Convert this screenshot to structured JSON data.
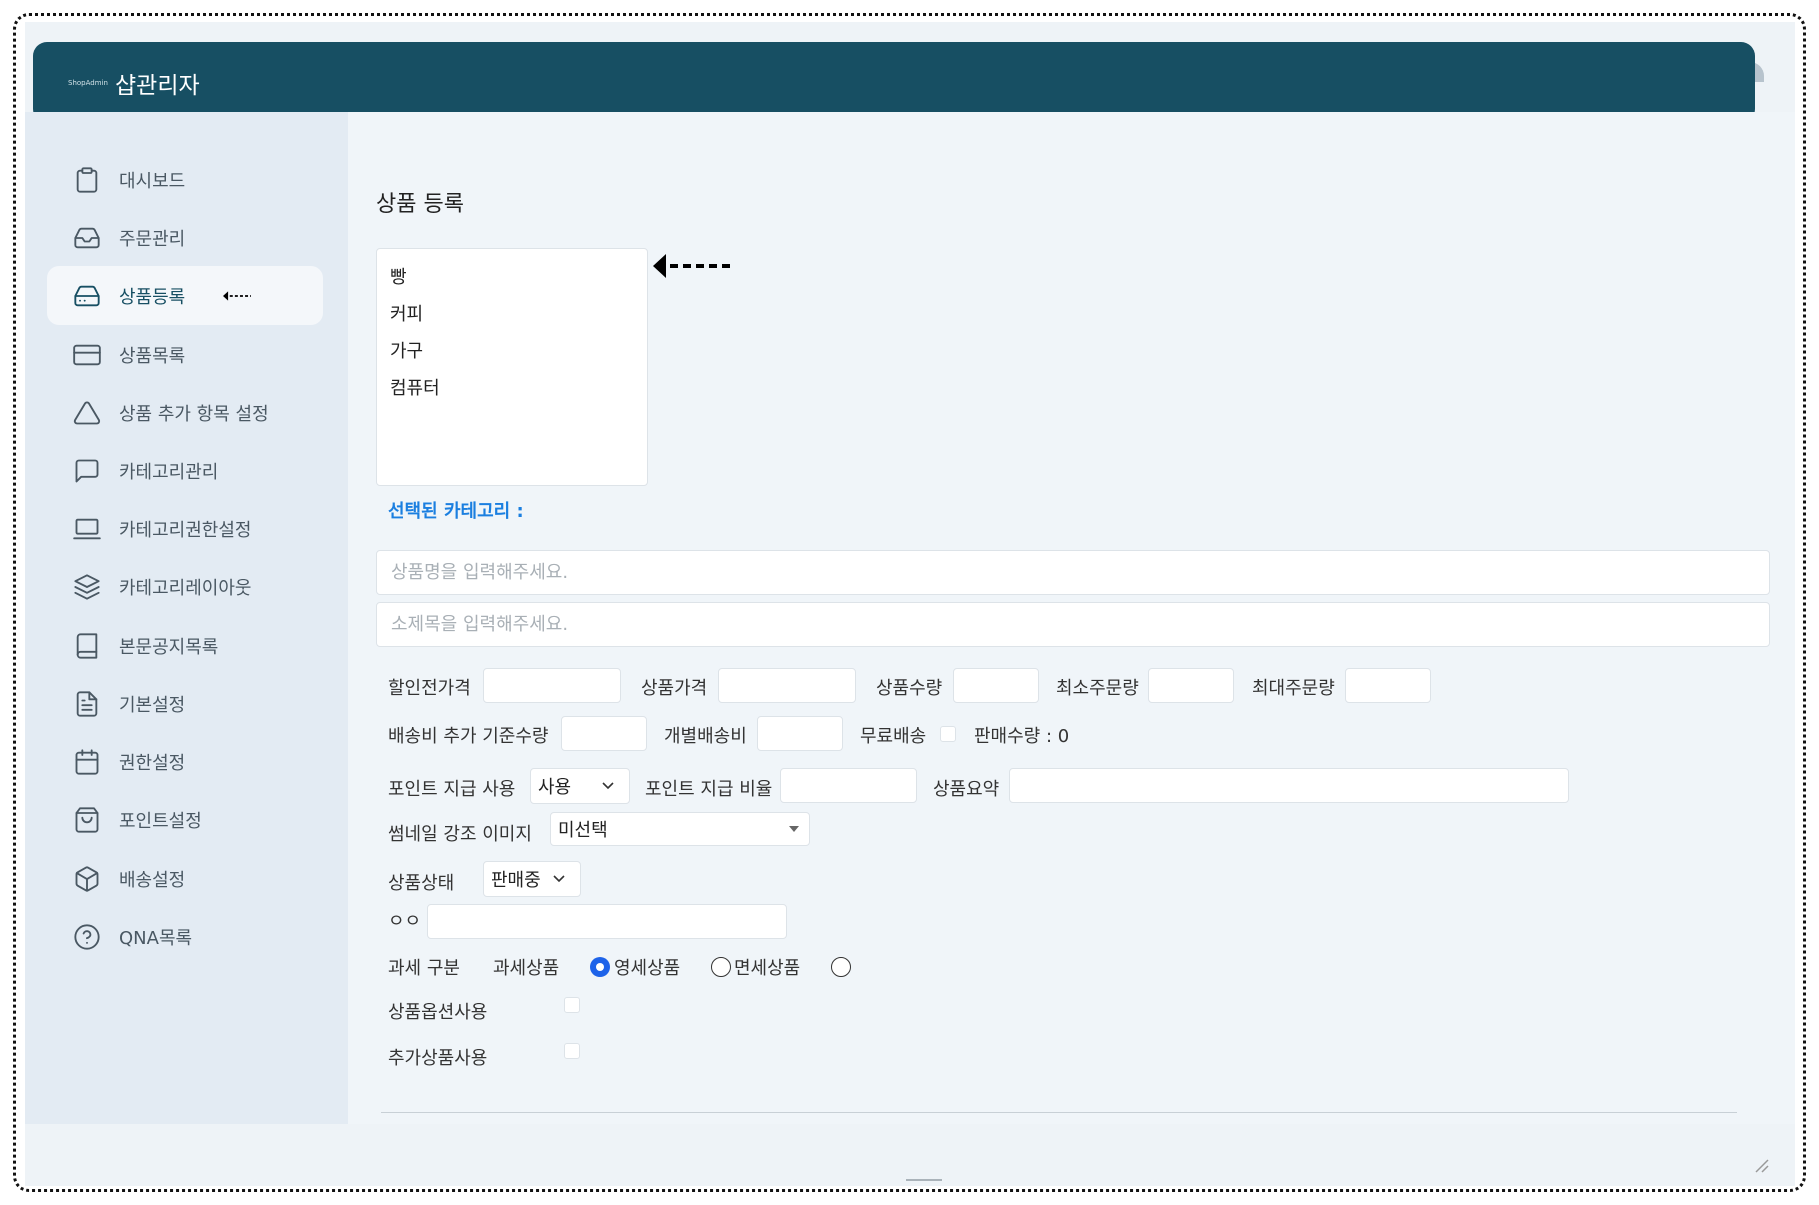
{
  "header": {
    "logo_text": "ShopAdmin",
    "title": "샵관리자"
  },
  "sidebar": {
    "items": [
      {
        "label": "대시보드",
        "icon": "clipboard-icon"
      },
      {
        "label": "주문관리",
        "icon": "inbox-icon"
      },
      {
        "label": "상품등록",
        "icon": "hard-drive-icon",
        "active": true
      },
      {
        "label": "상품목록",
        "icon": "credit-card-icon"
      },
      {
        "label": "상품 추가 항목 설정",
        "icon": "triangle-icon"
      },
      {
        "label": "카테고리관리",
        "icon": "message-square-icon"
      },
      {
        "label": "카테고리권한설정",
        "icon": "laptop-icon"
      },
      {
        "label": "카테고리레이아웃",
        "icon": "layers-icon"
      },
      {
        "label": "본문공지목록",
        "icon": "book-icon"
      },
      {
        "label": "기본설정",
        "icon": "file-text-icon"
      },
      {
        "label": "권한설정",
        "icon": "calendar-icon"
      },
      {
        "label": "포인트설정",
        "icon": "shopping-bag-icon"
      },
      {
        "label": "배송설정",
        "icon": "box-icon"
      },
      {
        "label": "QNA목록",
        "icon": "help-circle-icon"
      }
    ]
  },
  "main": {
    "title": "상품 등록",
    "categories": [
      "빵",
      "커피",
      "가구",
      "컴퓨터"
    ],
    "selected_category_label": "선택된 카테고리 :",
    "product_name_placeholder": "상품명을 입력해주세요.",
    "subtitle_placeholder": "소제목을 입력해주세요.",
    "row1": {
      "list_price": "할인전가격",
      "price": "상품가격",
      "quantity": "상품수량",
      "min_order": "최소주문량",
      "max_order": "최대주문량"
    },
    "row2": {
      "ship_extra": "배송비 추가 기준수량",
      "individual_ship": "개별배송비",
      "free_ship": "무료배송",
      "sold_count": "판매수량 : 0"
    },
    "row3": {
      "point_use": "포인트 지급 사용",
      "point_use_value": "사용",
      "point_rate": "포인트 지급 비율",
      "summary": "상품요약"
    },
    "thumbnail": {
      "label": "썸네일 강조 이미지",
      "value": "미선택"
    },
    "status": {
      "label": "상품상태",
      "value": "판매중"
    },
    "misc_label": "ㅇㅇ",
    "tax": {
      "label": "과세 구분",
      "options": [
        "과세상품",
        "영세상품",
        "면세상품"
      ],
      "selected": "과세상품"
    },
    "option_use_label": "상품옵션사용",
    "addon_use_label": "추가상품사용"
  },
  "colors": {
    "header_bg": "#174f63",
    "accent_blue": "#1b7fe0",
    "radio_selected": "#1e63e9"
  }
}
